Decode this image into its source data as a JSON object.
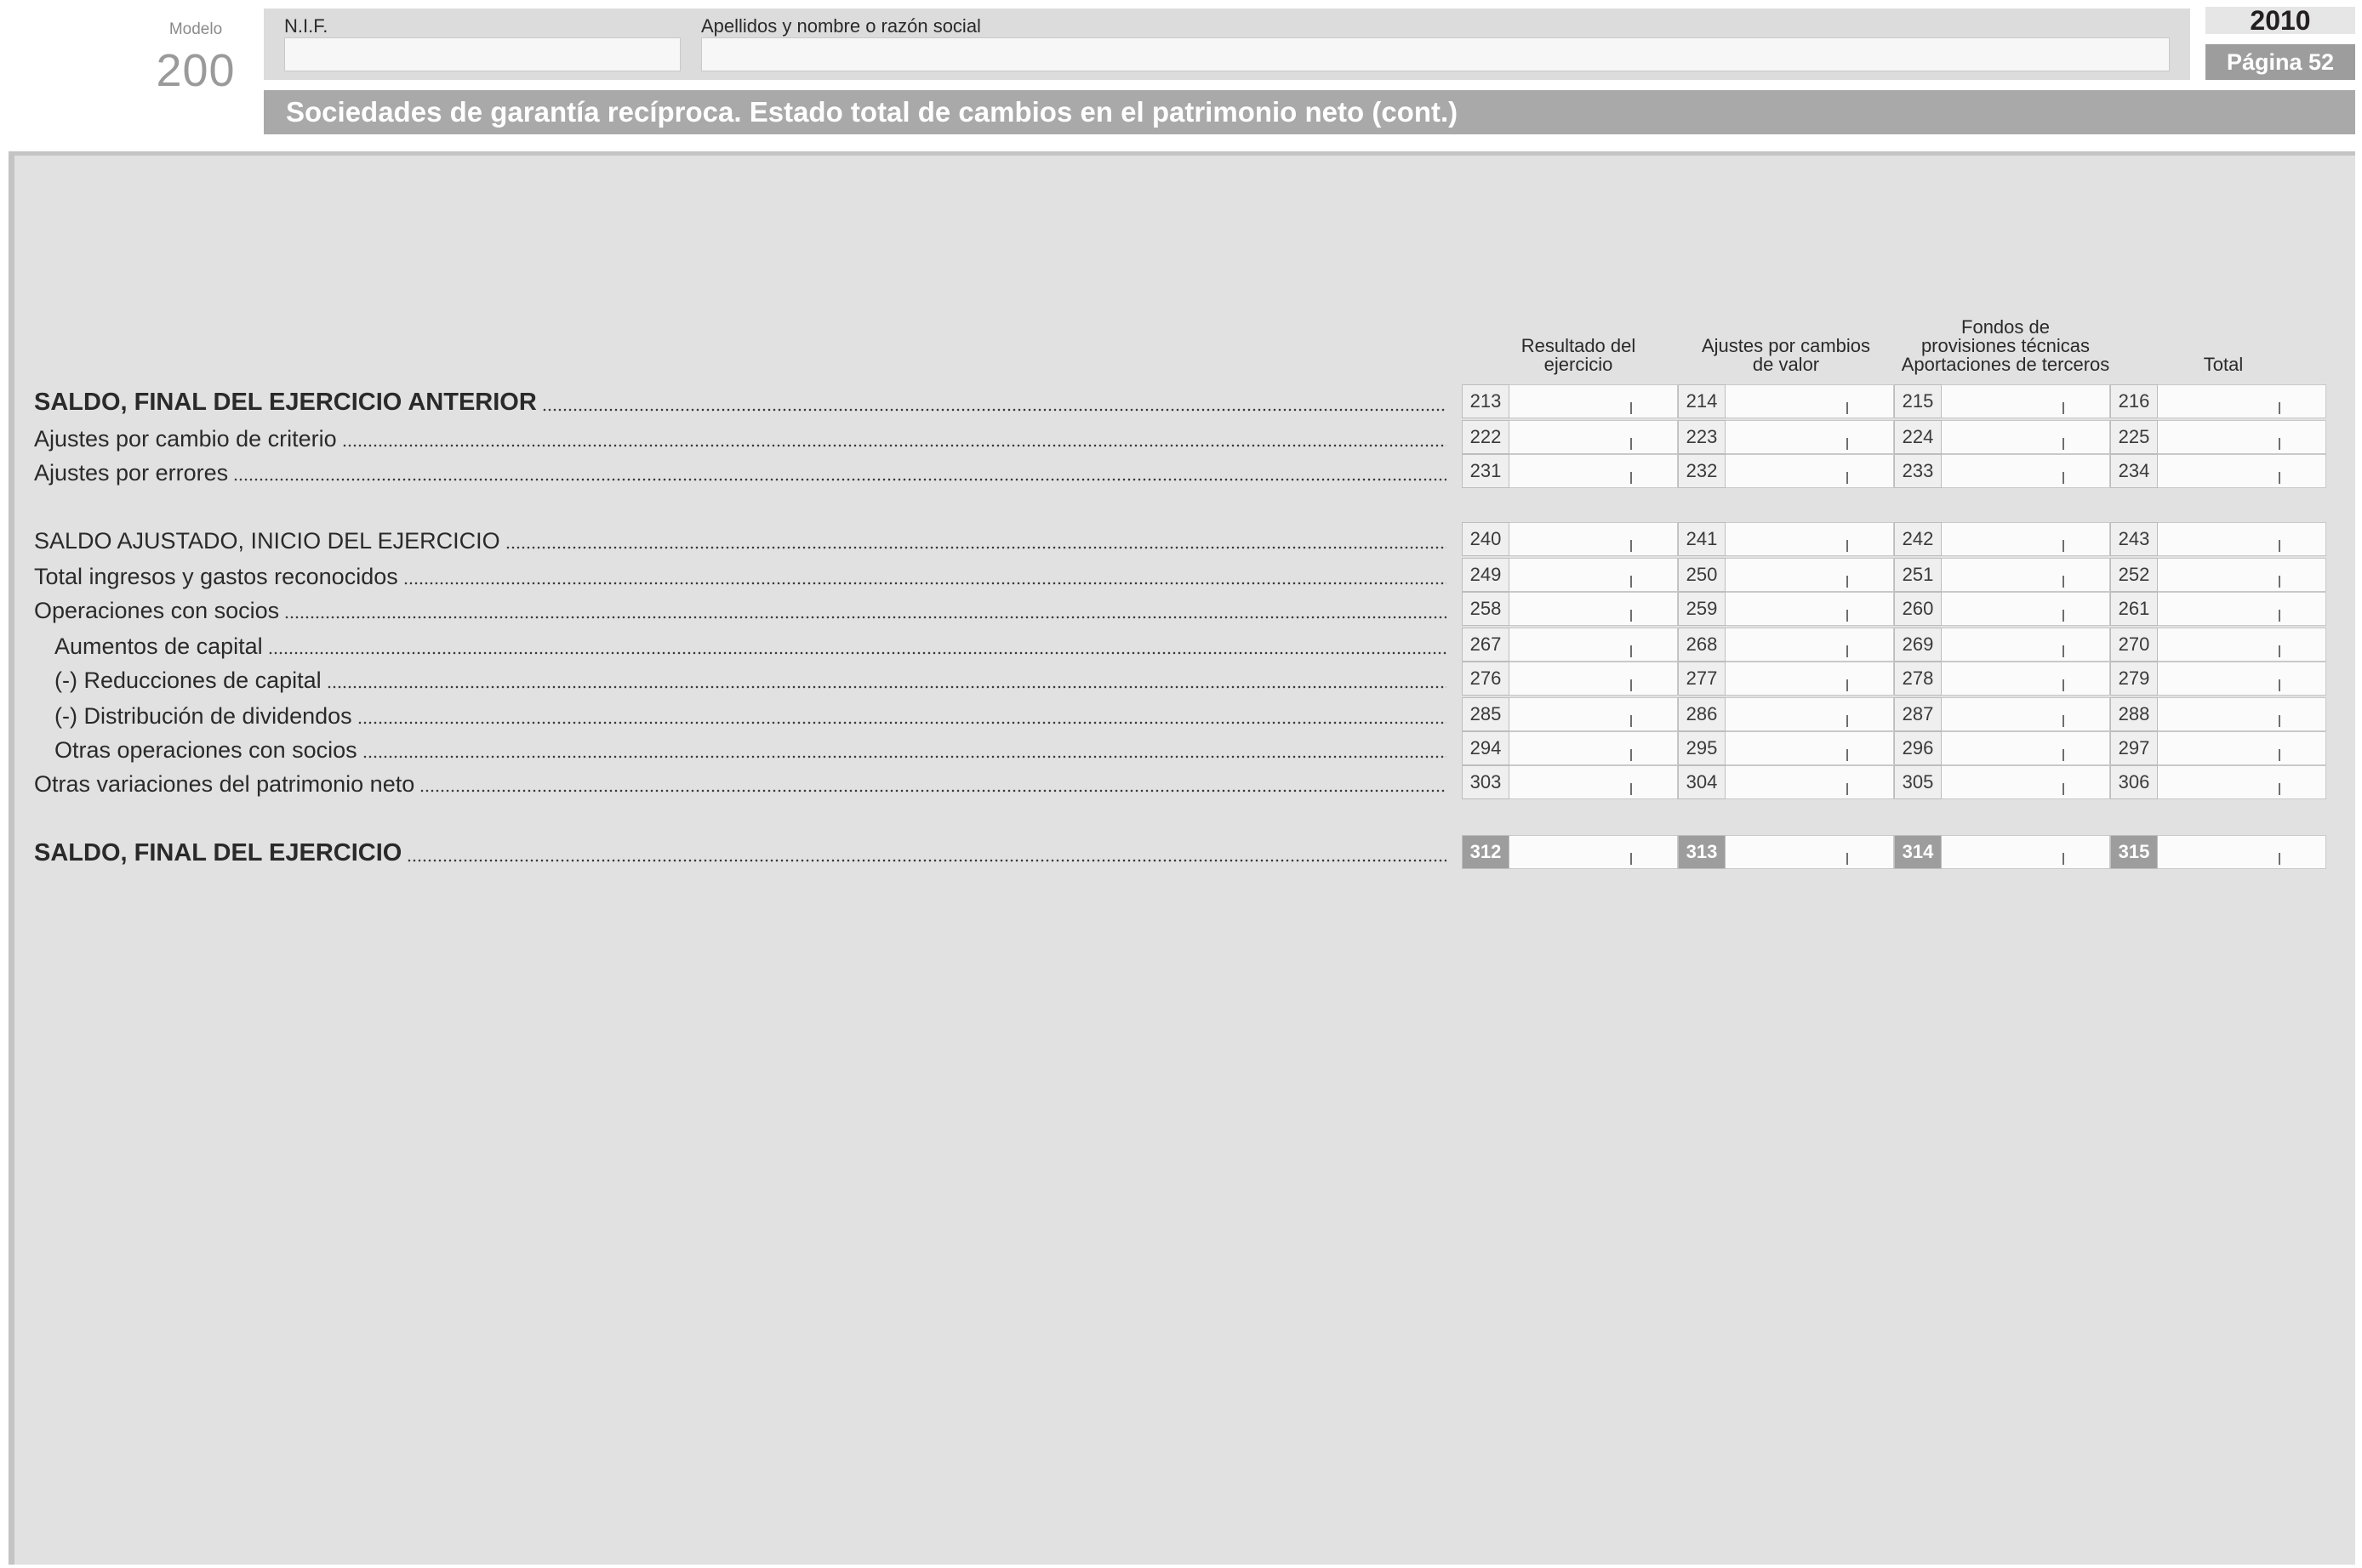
{
  "header": {
    "modelo_label": "Modelo",
    "modelo_number": "200",
    "nif_label": "N.I.F.",
    "name_label": "Apellidos y nombre o razón social",
    "year": "2010",
    "page": "Página 52",
    "title": "Sociedades de garantía recíproca. Estado total de cambios en el patrimonio neto (cont.)"
  },
  "columns": [
    {
      "lines": [
        "Resultado del",
        "ejercicio"
      ]
    },
    {
      "lines": [
        "Ajustes por cambios",
        "de valor"
      ]
    },
    {
      "lines": [
        "Fondos de",
        "provisiones técnicas",
        "Aportaciones de terceros"
      ]
    },
    {
      "lines": [
        "Total"
      ]
    }
  ],
  "rows": [
    {
      "label": "SALDO, FINAL DEL EJERCICIO ANTERIOR",
      "bold": true,
      "codes": [
        "213",
        "214",
        "215",
        "216"
      ]
    },
    {
      "label": "Ajustes por cambio de criterio",
      "codes": [
        "222",
        "223",
        "224",
        "225"
      ]
    },
    {
      "label": "Ajustes por errores",
      "codes": [
        "231",
        "232",
        "233",
        "234"
      ]
    },
    {
      "label": "SALDO AJUSTADO, INICIO DEL EJERCICIO",
      "codes": [
        "240",
        "241",
        "242",
        "243"
      ]
    },
    {
      "label": "Total ingresos y gastos reconocidos",
      "codes": [
        "249",
        "250",
        "251",
        "252"
      ]
    },
    {
      "label": "Operaciones con socios",
      "codes": [
        "258",
        "259",
        "260",
        "261"
      ]
    },
    {
      "label": "Aumentos de capital",
      "indent": true,
      "codes": [
        "267",
        "268",
        "269",
        "270"
      ]
    },
    {
      "label": "(-) Reducciones de capital",
      "indent": true,
      "codes": [
        "276",
        "277",
        "278",
        "279"
      ]
    },
    {
      "label": "(-) Distribución de dividendos",
      "indent": true,
      "codes": [
        "285",
        "286",
        "287",
        "288"
      ]
    },
    {
      "label": "Otras operaciones con socios",
      "indent": true,
      "codes": [
        "294",
        "295",
        "296",
        "297"
      ]
    },
    {
      "label": "Otras variaciones del patrimonio neto",
      "codes": [
        "303",
        "304",
        "305",
        "306"
      ]
    },
    {
      "label": "SALDO, FINAL DEL EJERCICIO",
      "bold": true,
      "dark_codes": true,
      "codes": [
        "312",
        "313",
        "314",
        "315"
      ]
    }
  ]
}
